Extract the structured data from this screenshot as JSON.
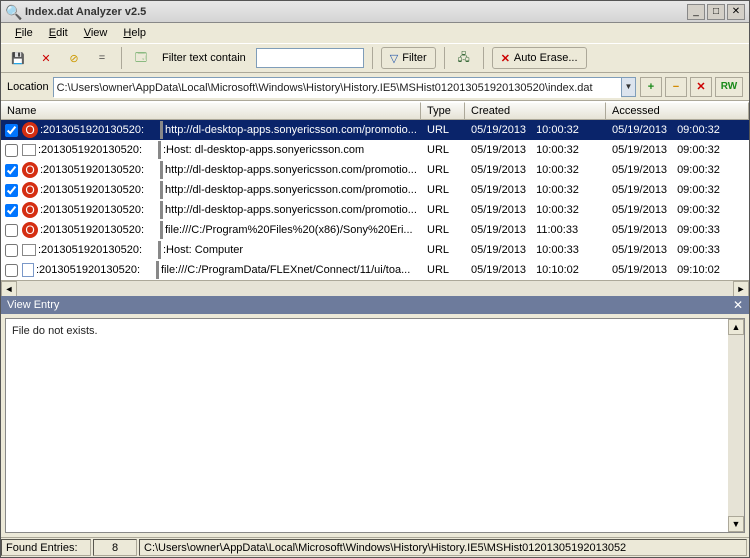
{
  "window": {
    "title": "Index.dat Analyzer v2.5"
  },
  "menu": {
    "file": "File",
    "edit": "Edit",
    "view": "View",
    "help": "Help"
  },
  "toolbar": {
    "filter_text_label": "Filter text contain",
    "filter_button": "Filter",
    "auto_erase": "Auto Erase..."
  },
  "location": {
    "label": "Location",
    "path": "C:\\Users\\owner\\AppData\\Local\\Microsoft\\Windows\\History\\History.IE5\\MSHist012013051920130520\\index.dat",
    "rw": "RW"
  },
  "columns": {
    "name": "Name",
    "type": "Type",
    "created": "Created",
    "accessed": "Accessed"
  },
  "rows": [
    {
      "checked": true,
      "icon": "o",
      "ts": ":2013051920130520:",
      "url": "http://dl-desktop-apps.sonyericsson.com/promotio...",
      "type": "URL",
      "cd": "05/19/2013",
      "ct": "10:00:32",
      "ad": "05/19/2013",
      "at": "09:00:32",
      "selected": true
    },
    {
      "checked": false,
      "icon": "g",
      "ts": ":2013051920130520:",
      "url": ":Host: dl-desktop-apps.sonyericsson.com",
      "type": "URL",
      "cd": "05/19/2013",
      "ct": "10:00:32",
      "ad": "05/19/2013",
      "at": "09:00:32"
    },
    {
      "checked": true,
      "icon": "o",
      "ts": ":2013051920130520:",
      "url": "http://dl-desktop-apps.sonyericsson.com/promotio...",
      "type": "URL",
      "cd": "05/19/2013",
      "ct": "10:00:32",
      "ad": "05/19/2013",
      "at": "09:00:32"
    },
    {
      "checked": true,
      "icon": "o",
      "ts": ":2013051920130520:",
      "url": "http://dl-desktop-apps.sonyericsson.com/promotio...",
      "type": "URL",
      "cd": "05/19/2013",
      "ct": "10:00:32",
      "ad": "05/19/2013",
      "at": "09:00:32"
    },
    {
      "checked": true,
      "icon": "o",
      "ts": ":2013051920130520:",
      "url": "http://dl-desktop-apps.sonyericsson.com/promotio...",
      "type": "URL",
      "cd": "05/19/2013",
      "ct": "10:00:32",
      "ad": "05/19/2013",
      "at": "09:00:32"
    },
    {
      "checked": false,
      "icon": "o",
      "ts": ":2013051920130520:",
      "url": "file:///C:/Program%20Files%20(x86)/Sony%20Eri...",
      "type": "URL",
      "cd": "05/19/2013",
      "ct": "11:00:33",
      "ad": "05/19/2013",
      "at": "09:00:33"
    },
    {
      "checked": false,
      "icon": "g",
      "ts": ":2013051920130520:",
      "url": ":Host: Computer",
      "type": "URL",
      "cd": "05/19/2013",
      "ct": "10:00:33",
      "ad": "05/19/2013",
      "at": "09:00:33"
    },
    {
      "checked": false,
      "icon": "b",
      "ts": ":2013051920130520:",
      "url": "file:///C:/ProgramData/FLEXnet/Connect/11/ui/toa...",
      "type": "URL",
      "cd": "05/19/2013",
      "ct": "10:10:02",
      "ad": "05/19/2013",
      "at": "09:10:02"
    }
  ],
  "view_entry": {
    "title": "View Entry",
    "body": "File do not exists."
  },
  "status": {
    "found_label": "Found Entries:",
    "count": "8",
    "path": "C:\\Users\\owner\\AppData\\Local\\Microsoft\\Windows\\History\\History.IE5\\MSHist01201305192013052"
  }
}
